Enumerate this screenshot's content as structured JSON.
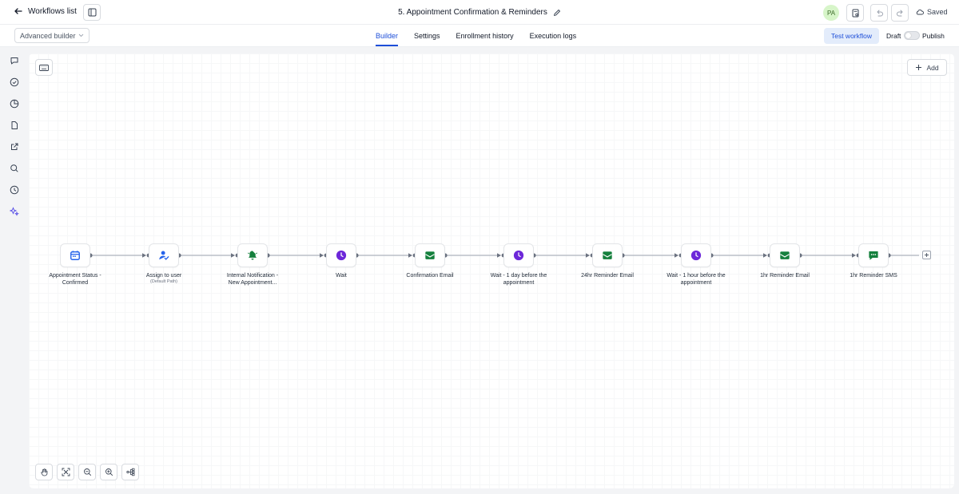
{
  "header": {
    "back_label": "Workflows list",
    "title": "5. Appointment Confirmation & Reminders",
    "avatar_initials": "PA",
    "saved_label": "Saved"
  },
  "subbar": {
    "builder_mode": "Advanced builder",
    "tabs": [
      {
        "label": "Builder",
        "active": true
      },
      {
        "label": "Settings",
        "active": false
      },
      {
        "label": "Enrollment history",
        "active": false
      },
      {
        "label": "Execution logs",
        "active": false
      }
    ],
    "test_label": "Test workflow",
    "draft_label": "Draft",
    "publish_label": "Publish",
    "published": false
  },
  "left_rail": {
    "icons": [
      "chat-bubble-icon",
      "check-circle-icon",
      "pie-chart-icon",
      "document-icon",
      "external-link-icon",
      "search-icon",
      "history-icon",
      "ai-sparkle-icon"
    ]
  },
  "canvas": {
    "add_label": "Add",
    "nodes": [
      {
        "label": "Appointment Status - Confirmed",
        "sub": "",
        "icon": "calendar-icon",
        "color": "#2563eb"
      },
      {
        "label": "Assign to user",
        "sub": "(Default Path)",
        "icon": "user-assign-icon",
        "color": "#2563eb"
      },
      {
        "label": "Internal Notification - New Appointment...",
        "sub": "",
        "icon": "bell-icon",
        "color": "#15803d"
      },
      {
        "label": "Wait",
        "sub": "",
        "icon": "clock-icon",
        "color": "#6d28d9"
      },
      {
        "label": "Confirmation Email",
        "sub": "",
        "icon": "email-icon",
        "color": "#15803d"
      },
      {
        "label": "Wait - 1 day before the appointment",
        "sub": "",
        "icon": "clock-icon",
        "color": "#6d28d9"
      },
      {
        "label": "24hr Reminder Email",
        "sub": "",
        "icon": "email-icon",
        "color": "#15803d"
      },
      {
        "label": "Wait - 1 hour before the appointment",
        "sub": "",
        "icon": "clock-icon",
        "color": "#6d28d9"
      },
      {
        "label": "1hr Reminder Email",
        "sub": "",
        "icon": "email-icon",
        "color": "#15803d"
      },
      {
        "label": "1hr Reminder SMS",
        "sub": "",
        "icon": "sms-icon",
        "color": "#15803d"
      }
    ]
  },
  "zoom_controls": [
    "hand-icon",
    "fit-view-icon",
    "zoom-out-icon",
    "zoom-in-icon",
    "auto-layout-icon"
  ]
}
